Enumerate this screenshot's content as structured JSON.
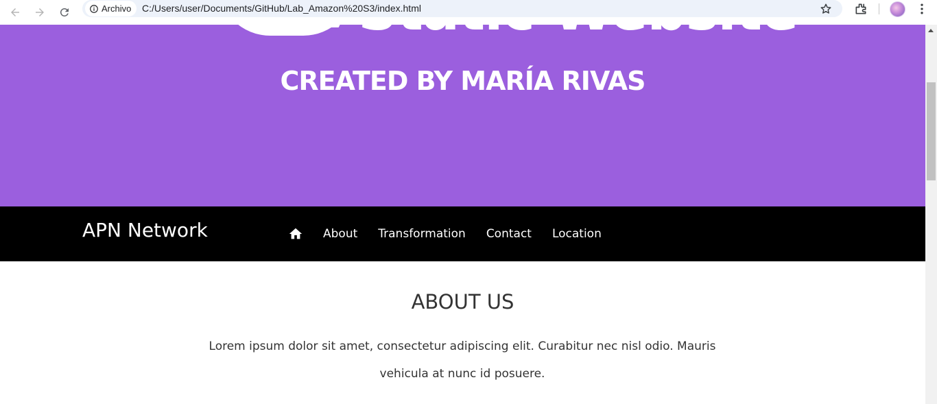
{
  "browser": {
    "site_chip": "Archivo",
    "url": "C:/Users/user/Documents/GitHub/Lab_Amazon%20S3/index.html",
    "icons": [
      "back-icon",
      "forward-icon",
      "reload-icon",
      "info-icon",
      "star-icon",
      "extensions-icon",
      "profile-avatar",
      "menu-icon"
    ]
  },
  "hero": {
    "big_title": "Static Website",
    "subtitle": "CREATED BY MARÍA RIVAS",
    "background_color": "#9b5fde"
  },
  "navbar": {
    "brand": "APN Network",
    "links": [
      "About",
      "Transformation",
      "Contact",
      "Location"
    ],
    "home_icon": "home-icon",
    "background_color": "#000000"
  },
  "about": {
    "title": "ABOUT US",
    "text": "Lorem ipsum dolor sit amet, consectetur adipiscing elit. Curabitur nec nisl odio. Mauris vehicula at nunc id posuere."
  }
}
